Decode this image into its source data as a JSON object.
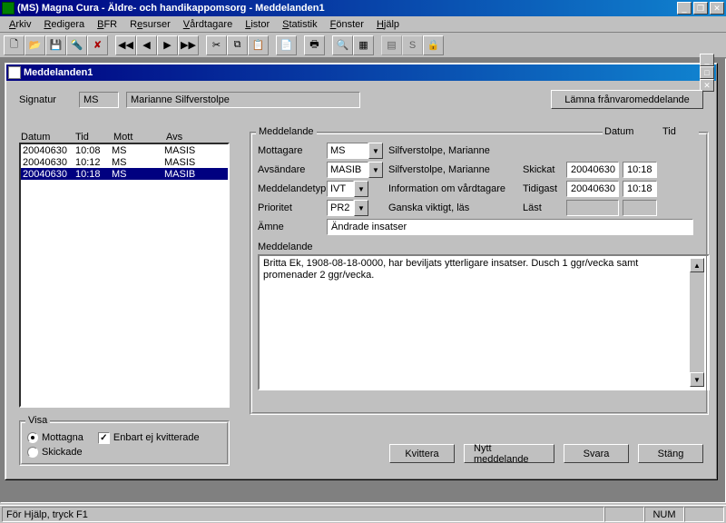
{
  "app": {
    "title": "(MS) Magna Cura - Äldre- och handikappomsorg - Meddelanden1"
  },
  "menu": {
    "arkiv": "Arkiv",
    "redigera": "Redigera",
    "bfr": "BFR",
    "resurser": "Resurser",
    "vardtagare": "Vårdtagare",
    "listor": "Listor",
    "statistik": "Statistik",
    "fonster": "Fönster",
    "hjalp": "Hjälp"
  },
  "child": {
    "title": "Meddelanden1"
  },
  "signatur": {
    "label": "Signatur",
    "code": "MS",
    "name": "Marianne Silfverstolpe"
  },
  "absence_btn": "Lämna frånvaromeddelande",
  "list": {
    "headers": {
      "datum": "Datum",
      "tid": "Tid",
      "mott": "Mott",
      "avs": "Avs"
    },
    "rows": [
      {
        "datum": "20040630",
        "tid": "10:08",
        "mott": "MS",
        "avs": "MASIS"
      },
      {
        "datum": "20040630",
        "tid": "10:12",
        "mott": "MS",
        "avs": "MASIS"
      },
      {
        "datum": "20040630",
        "tid": "10:18",
        "mott": "MS",
        "avs": "MASIB"
      }
    ]
  },
  "msg": {
    "group": "Meddelande",
    "mottagare_lbl": "Mottagare",
    "mottagare": "MS",
    "mottagare_name": "Silfverstolpe, Marianne",
    "avsandare_lbl": "Avsändare",
    "avsandare": "MASIB",
    "avsandare_name": "Silfverstolpe, Marianne",
    "typ_lbl": "Meddelandetyp",
    "typ": "IVT",
    "typ_name": "Information om vårdtagare",
    "prio_lbl": "Prioritet",
    "prio": "PR2",
    "prio_name": "Ganska viktigt, läs",
    "amne_lbl": "Ämne",
    "amne": "Ändrade insatser",
    "datum_lbl": "Datum",
    "tid_lbl": "Tid",
    "skickat_lbl": "Skickat",
    "skickat_d": "20040630",
    "skickat_t": "10:18",
    "tidigast_lbl": "Tidigast",
    "tidigast_d": "20040630",
    "tidigast_t": "10:18",
    "last_lbl": "Läst",
    "last_d": "",
    "last_t": "",
    "body_lbl": "Meddelande",
    "body": "Britta Ek, 1908-08-18-0000, har beviljats ytterligare insatser. Dusch 1 ggr/vecka samt promenader 2 ggr/vecka."
  },
  "visa": {
    "group": "Visa",
    "mottagna": "Mottagna",
    "skickade": "Skickade",
    "enbart": "Enbart ej kvitterade"
  },
  "buttons": {
    "kvittera": "Kvittera",
    "nytt": "Nytt meddelande",
    "svara": "Svara",
    "stang": "Stäng"
  },
  "status": {
    "help": "För Hjälp, tryck F1",
    "num": "NUM"
  }
}
